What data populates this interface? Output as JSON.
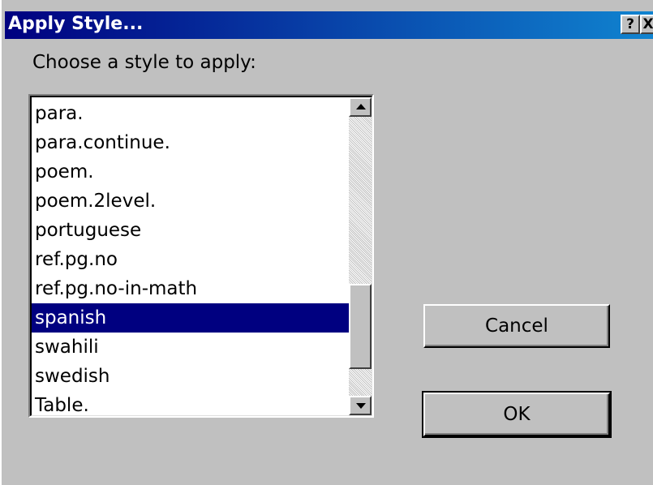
{
  "window": {
    "title": "Apply Style...",
    "help_label": "?",
    "close_label": "X"
  },
  "dialog": {
    "prompt": "Choose a style to apply:",
    "styles": [
      "para.",
      "para.continue.",
      "poem.",
      "poem.2level.",
      "portuguese",
      "ref.pg.no",
      "ref.pg.no-in-math",
      "spanish",
      "swahili",
      "swedish",
      "Table."
    ],
    "selected": "spanish",
    "cancel_label": "Cancel",
    "ok_label": "OK"
  },
  "colors": {
    "selection": "#000080",
    "face": "#c0c0c0"
  }
}
